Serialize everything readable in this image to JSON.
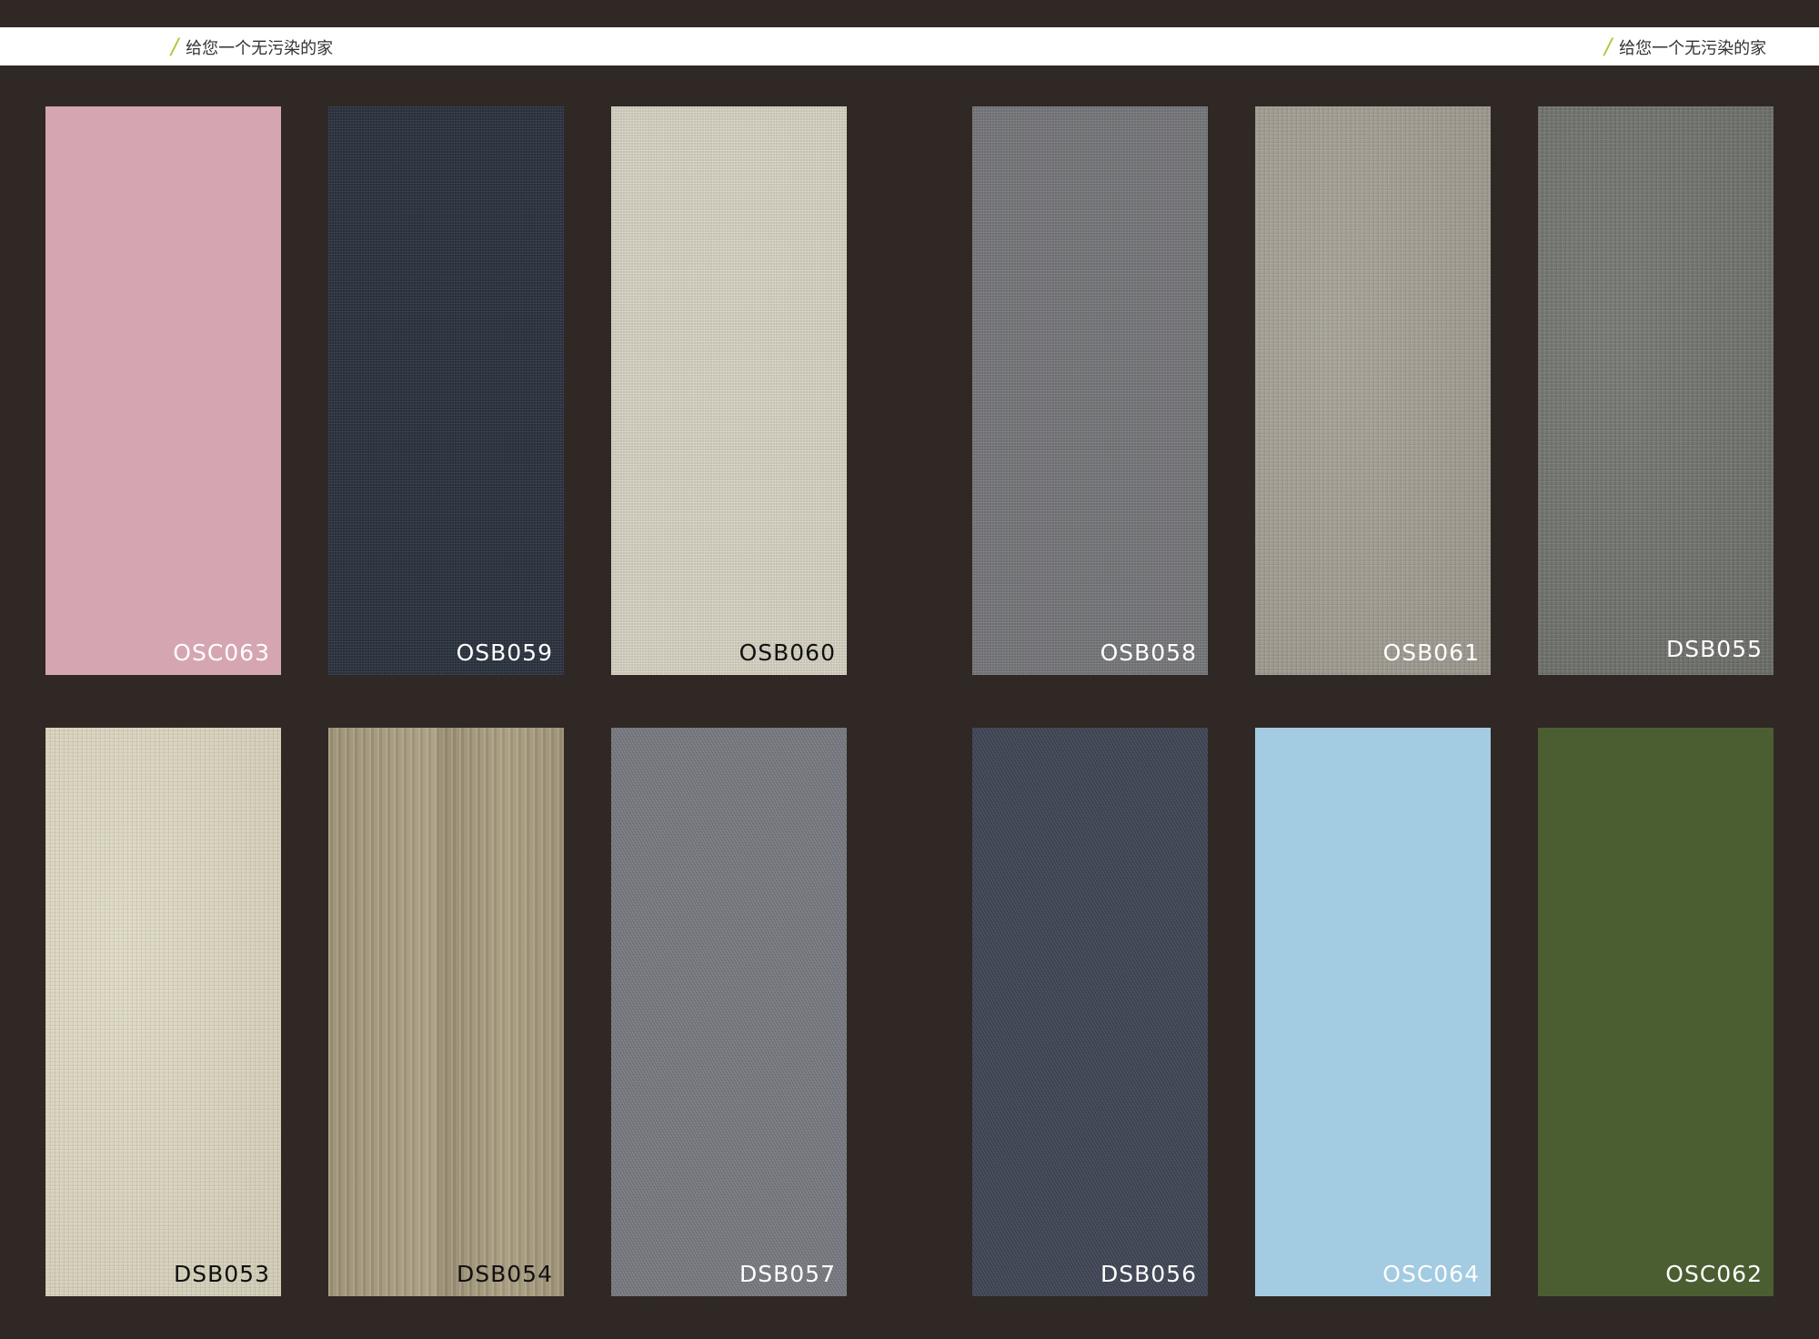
{
  "header": {
    "tagline_left": "给您一个无污染的家",
    "tagline_right": "给您一个无污染的家",
    "accent_color": "#b5c43a"
  },
  "swatches": [
    {
      "code": "OSC063",
      "color": "#d5a6b1",
      "texture": "plain"
    },
    {
      "code": "OSB059",
      "color": "#2c3541",
      "texture": "weave"
    },
    {
      "code": "OSB060",
      "color": "#ddd8c8",
      "texture": "weave"
    },
    {
      "code": "OSB058",
      "color": "#7a7b7e",
      "texture": "weave"
    },
    {
      "code": "OSB061",
      "color": "#a29d92",
      "texture": "linen"
    },
    {
      "code": "DSB055",
      "color": "#6f716c",
      "texture": "linen"
    },
    {
      "code": "DSB053",
      "color": "#ddd8c0",
      "texture": "linen"
    },
    {
      "code": "DSB054",
      "color": "#a99d80",
      "texture": "stripe"
    },
    {
      "code": "DSB057",
      "color": "#7d7f86",
      "texture": "twill"
    },
    {
      "code": "DSB056",
      "color": "#444a5a",
      "texture": "twill"
    },
    {
      "code": "OSC064",
      "color": "#a3cbe1",
      "texture": "plain"
    },
    {
      "code": "OSC062",
      "color": "#4b5e32",
      "texture": "plain"
    }
  ]
}
